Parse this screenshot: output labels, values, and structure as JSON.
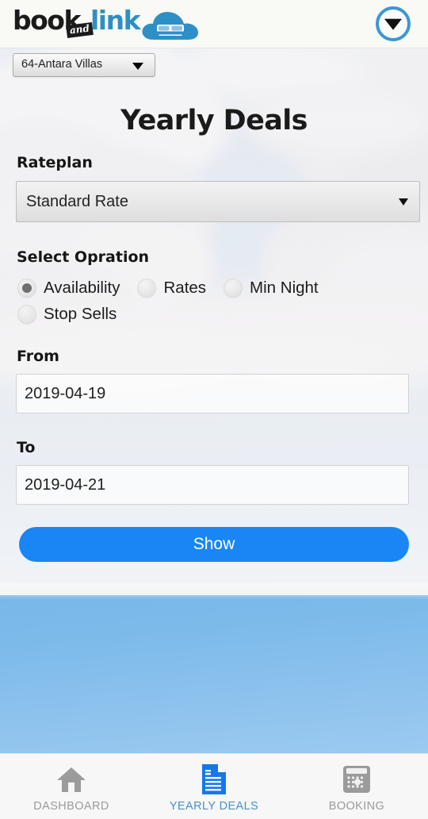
{
  "header": {
    "logo": {
      "part1": "book",
      "badge": "and",
      "part2": "link",
      "icon": "cloud-bed-logo-icon",
      "blue": "#2e8fc6",
      "black": "#1b1b1b"
    },
    "menu_button": {
      "name": "dropdown-menu-button",
      "icon": "chevron-down-icon",
      "ring_color": "#3b97d3"
    }
  },
  "property_selector": {
    "value": "64-Antara Villas",
    "icon": "caret-down-icon"
  },
  "page": {
    "title": "Yearly Deals"
  },
  "form": {
    "rateplan": {
      "label": "Rateplan",
      "value": "Standard Rate",
      "icon": "caret-down-icon"
    },
    "operation": {
      "label": "Select Opration",
      "options": [
        {
          "label": "Availability",
          "checked": true
        },
        {
          "label": "Rates",
          "checked": false
        },
        {
          "label": "Min Night",
          "checked": false
        },
        {
          "label": "Stop Sells",
          "checked": false
        }
      ]
    },
    "from": {
      "label": "From",
      "value": "2019-04-19"
    },
    "to": {
      "label": "To",
      "value": "2019-04-21"
    },
    "submit": {
      "label": "Show",
      "color": "#1a86f5"
    }
  },
  "bottom_nav": {
    "active_color": "#4a90c9",
    "inactive_color": "#9b9b9b",
    "items": [
      {
        "label": "DASHBOARD",
        "icon": "home-icon",
        "active": false
      },
      {
        "label": "YEARLY DEALS",
        "icon": "document-icon",
        "active": true
      },
      {
        "label": "BOOKING",
        "icon": "calendar-icon",
        "active": false
      }
    ]
  }
}
